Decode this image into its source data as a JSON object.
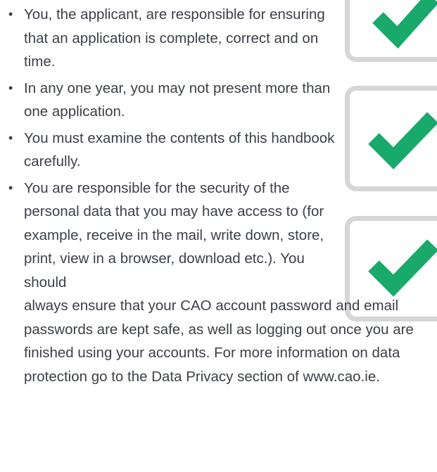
{
  "bullet_symbol": "•",
  "items": [
    "You, the applicant, are responsible for ensuring that an application is complete, correct and on time.",
    "In any one year, you may not present more than one application.",
    "You must examine the contents of this handbook carefully.",
    "You are responsible for the security of the personal data that you may have access to (for example, receive in the mail, write down, store, print, view in a browser, download etc.). You should"
  ],
  "item4_continuation": "always ensure that your CAO account password and email passwords are kept safe, as well as logging out once you are finished using your accounts. For more information on data protection go to the Data Privacy section of www.cao.ie.",
  "colors": {
    "text": "#3c4048",
    "checkmark": "#18a96b",
    "checkbox_border": "#d6d6d6"
  },
  "icons": [
    "checkbox-checked-icon",
    "checkbox-checked-icon",
    "checkbox-checked-icon"
  ]
}
